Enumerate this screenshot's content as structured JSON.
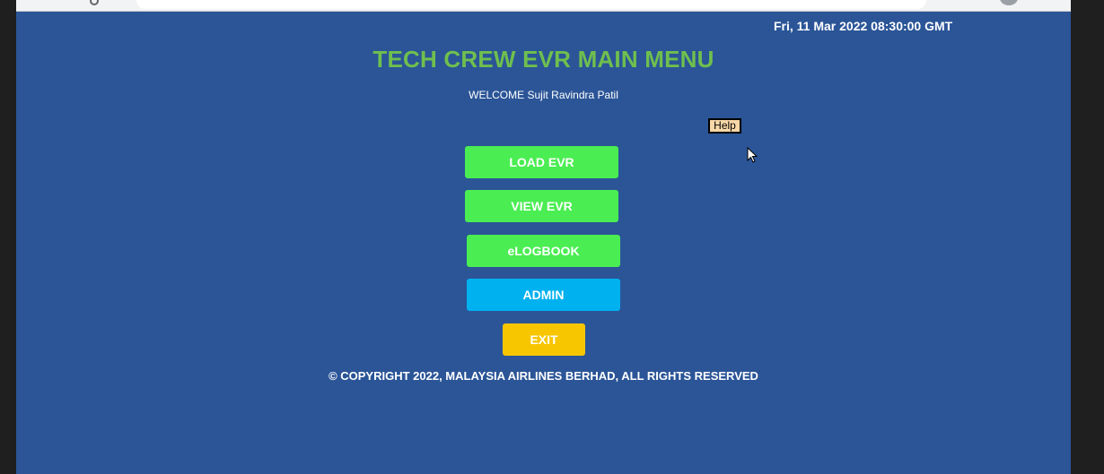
{
  "header": {
    "datetime": "Fri, 11 Mar 2022 08:30:00 GMT",
    "title": "TECH CREW EVR MAIN MENU",
    "welcome": "WELCOME Sujit Ravindra Patil"
  },
  "help": {
    "label": "Help"
  },
  "menu": {
    "load_evr": "LOAD EVR",
    "view_evr": "VIEW EVR",
    "elogbook": "eLOGBOOK",
    "admin": "ADMIN",
    "exit": "EXIT"
  },
  "footer": {
    "copyright": "© COPYRIGHT 2022, MALAYSIA AIRLINES BERHAD, ALL RIGHTS RESERVED"
  },
  "colors": {
    "page_bg": "#2b5597",
    "title": "#6fbf4e",
    "green_button": "#4aed52",
    "admin_button": "#00b1f0",
    "exit_button": "#f7c600",
    "help_button": "#f9d8a8"
  },
  "icons": [
    "back-icon",
    "reload-icon",
    "address-bar",
    "profile-avatar",
    "mouse-cursor-icon"
  ]
}
